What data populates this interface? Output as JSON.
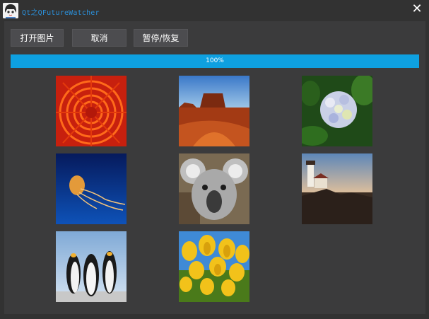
{
  "window": {
    "title": "Qt之QFutureWatcher",
    "close_glyph": "✕"
  },
  "toolbar": {
    "open_label": "打开图片",
    "cancel_label": "取消",
    "pause_resume_label": "暂停/恢复"
  },
  "progress": {
    "value": 100,
    "text": "100%"
  },
  "images": [
    {
      "name": "chrysanthemum"
    },
    {
      "name": "desert"
    },
    {
      "name": "hydrangeas"
    },
    {
      "name": "jellyfish"
    },
    {
      "name": "koala"
    },
    {
      "name": "lighthouse"
    },
    {
      "name": "penguins"
    },
    {
      "name": "tulips"
    }
  ],
  "colors": {
    "background": "#323232",
    "panel": "#3b3b3c",
    "button": "#4c4c4f",
    "progress": "#0ea0e0",
    "title_text": "#2b8fd8"
  }
}
